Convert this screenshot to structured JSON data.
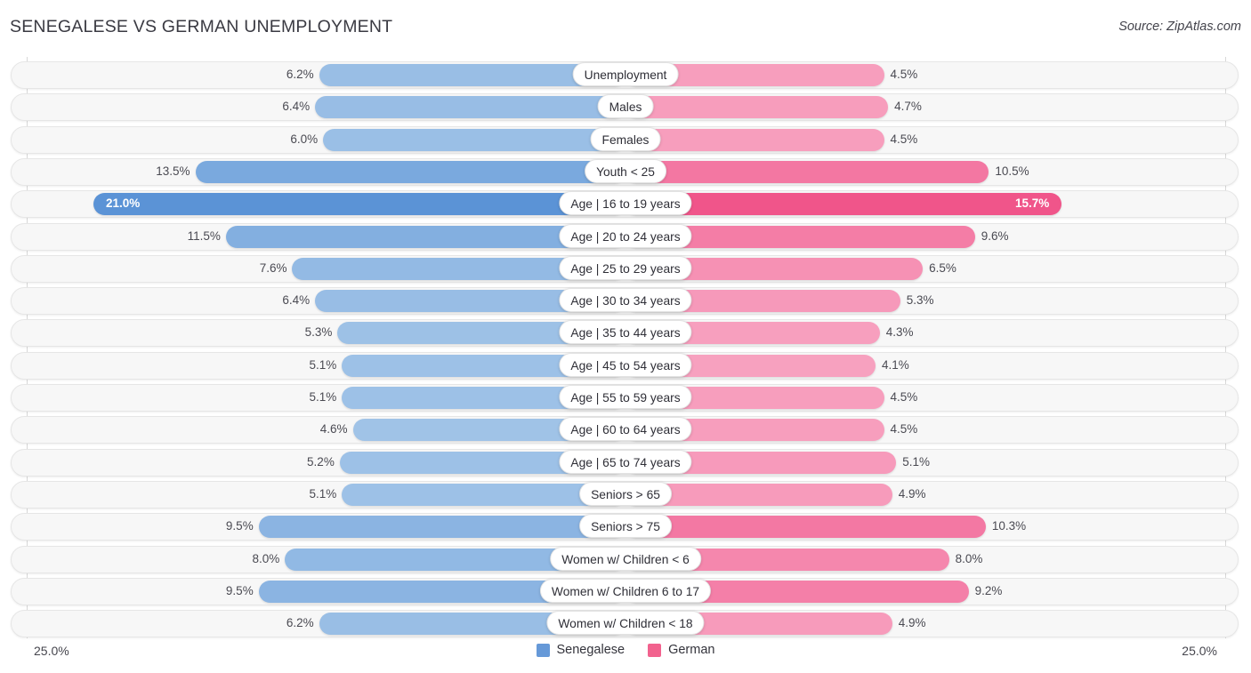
{
  "header": {
    "title": "SENEGALESE VS GERMAN UNEMPLOYMENT",
    "source": "Source: ZipAtlas.com"
  },
  "axis": {
    "left_label": "25.0%",
    "right_label": "25.0%",
    "max": 25.0
  },
  "legend": [
    {
      "label": "Senegalese",
      "color": "#6699d8"
    },
    {
      "label": "German",
      "color": "#f2628e"
    }
  ],
  "colors": {
    "left_series_light": "#a3c5e8",
    "left_series_dark": "#5b93d6",
    "right_series_light": "#f8a9c5",
    "right_series_dark": "#f0558a",
    "track_fill": "#f7f7f7",
    "track_border": "#e6e6e6",
    "gridline": "#d8d8d8"
  },
  "chart_data": {
    "type": "bar",
    "title": "SENEGALESE VS GERMAN UNEMPLOYMENT",
    "subtitle": "",
    "xlabel": "",
    "ylabel": "",
    "orientation": "horizontal-diverging",
    "xlim": [
      25.0,
      25.0
    ],
    "grid": true,
    "legend_position": "bottom-center",
    "categories": [
      "Unemployment",
      "Males",
      "Females",
      "Youth < 25",
      "Age | 16 to 19 years",
      "Age | 20 to 24 years",
      "Age | 25 to 29 years",
      "Age | 30 to 34 years",
      "Age | 35 to 44 years",
      "Age | 45 to 54 years",
      "Age | 55 to 59 years",
      "Age | 60 to 64 years",
      "Age | 65 to 74 years",
      "Seniors > 65",
      "Seniors > 75",
      "Women w/ Children < 6",
      "Women w/ Children 6 to 17",
      "Women w/ Children < 18"
    ],
    "series": [
      {
        "name": "Senegalese",
        "values": [
          6.2,
          6.4,
          6.0,
          13.5,
          21.0,
          11.5,
          7.6,
          6.4,
          5.3,
          5.1,
          5.1,
          4.6,
          5.2,
          5.1,
          9.5,
          8.0,
          9.5,
          6.2
        ],
        "labels": [
          "6.2%",
          "6.4%",
          "6.0%",
          "13.5%",
          "21.0%",
          "11.5%",
          "7.6%",
          "6.4%",
          "5.3%",
          "5.1%",
          "5.1%",
          "4.6%",
          "5.2%",
          "5.1%",
          "9.5%",
          "8.0%",
          "9.5%",
          "6.2%"
        ]
      },
      {
        "name": "German",
        "values": [
          4.5,
          4.7,
          4.5,
          10.5,
          15.7,
          9.6,
          6.5,
          5.3,
          4.3,
          4.1,
          4.5,
          4.5,
          5.1,
          4.9,
          10.3,
          8.0,
          9.2,
          4.9
        ],
        "labels": [
          "4.5%",
          "4.7%",
          "4.5%",
          "10.5%",
          "15.7%",
          "9.6%",
          "6.5%",
          "5.3%",
          "4.3%",
          "4.1%",
          "4.5%",
          "4.5%",
          "5.1%",
          "4.9%",
          "10.3%",
          "8.0%",
          "9.2%",
          "4.9%"
        ]
      }
    ]
  }
}
